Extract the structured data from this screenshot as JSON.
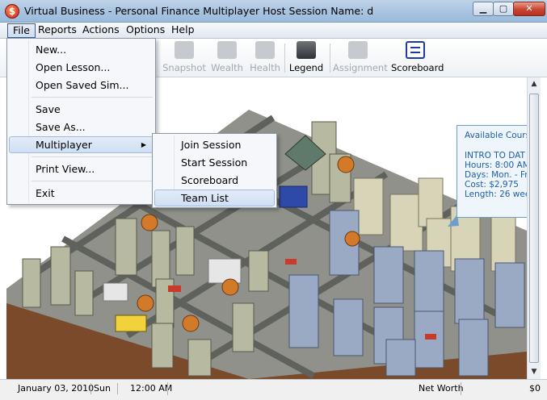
{
  "window": {
    "icon_glyph": "$",
    "title": "Virtual Business - Personal Finance Multiplayer Host   Session Name: d",
    "minimize_glyph": "▁",
    "maximize_glyph": "▢",
    "close_glyph": "✕"
  },
  "menubar": {
    "items": [
      "File",
      "Reports",
      "Actions",
      "Options",
      "Help"
    ]
  },
  "toolbar": {
    "snapshot": "Snapshot",
    "wealth": "Wealth",
    "health": "Health",
    "legend": "Legend",
    "assignment": "Assignment",
    "scoreboard": "Scoreboard"
  },
  "file_menu": {
    "new": "New...",
    "open_lesson": "Open Lesson...",
    "open_saved_sim": "Open Saved Sim...",
    "save": "Save",
    "save_as": "Save As...",
    "multiplayer": "Multiplayer",
    "print_view": "Print View...",
    "exit": "Exit"
  },
  "multiplayer_submenu": {
    "join_session": "Join Session",
    "start_session": "Start Session",
    "scoreboard": "Scoreboard",
    "team_list": "Team List"
  },
  "course_panel": {
    "heading": "Available Cours",
    "course_title": "INTRO TO DAT",
    "hours": "Hours: 8:00 AM",
    "days": "Days: Mon. - Fr",
    "cost": "Cost: $2,975",
    "length": "Length: 26 wee"
  },
  "statusbar": {
    "date": "January 03, 2010",
    "day": "Sun",
    "time": "12:00 AM",
    "net_worth_label": "Net Worth",
    "net_worth_value": "$0"
  },
  "colors": {
    "title_bar": "#a6c2e0",
    "menu_highlight": "#cfdff3",
    "course_text": "#1f5fa8",
    "ground": "#8a8c82",
    "road": "#6f716c",
    "dirt": "#7a4a2a"
  }
}
